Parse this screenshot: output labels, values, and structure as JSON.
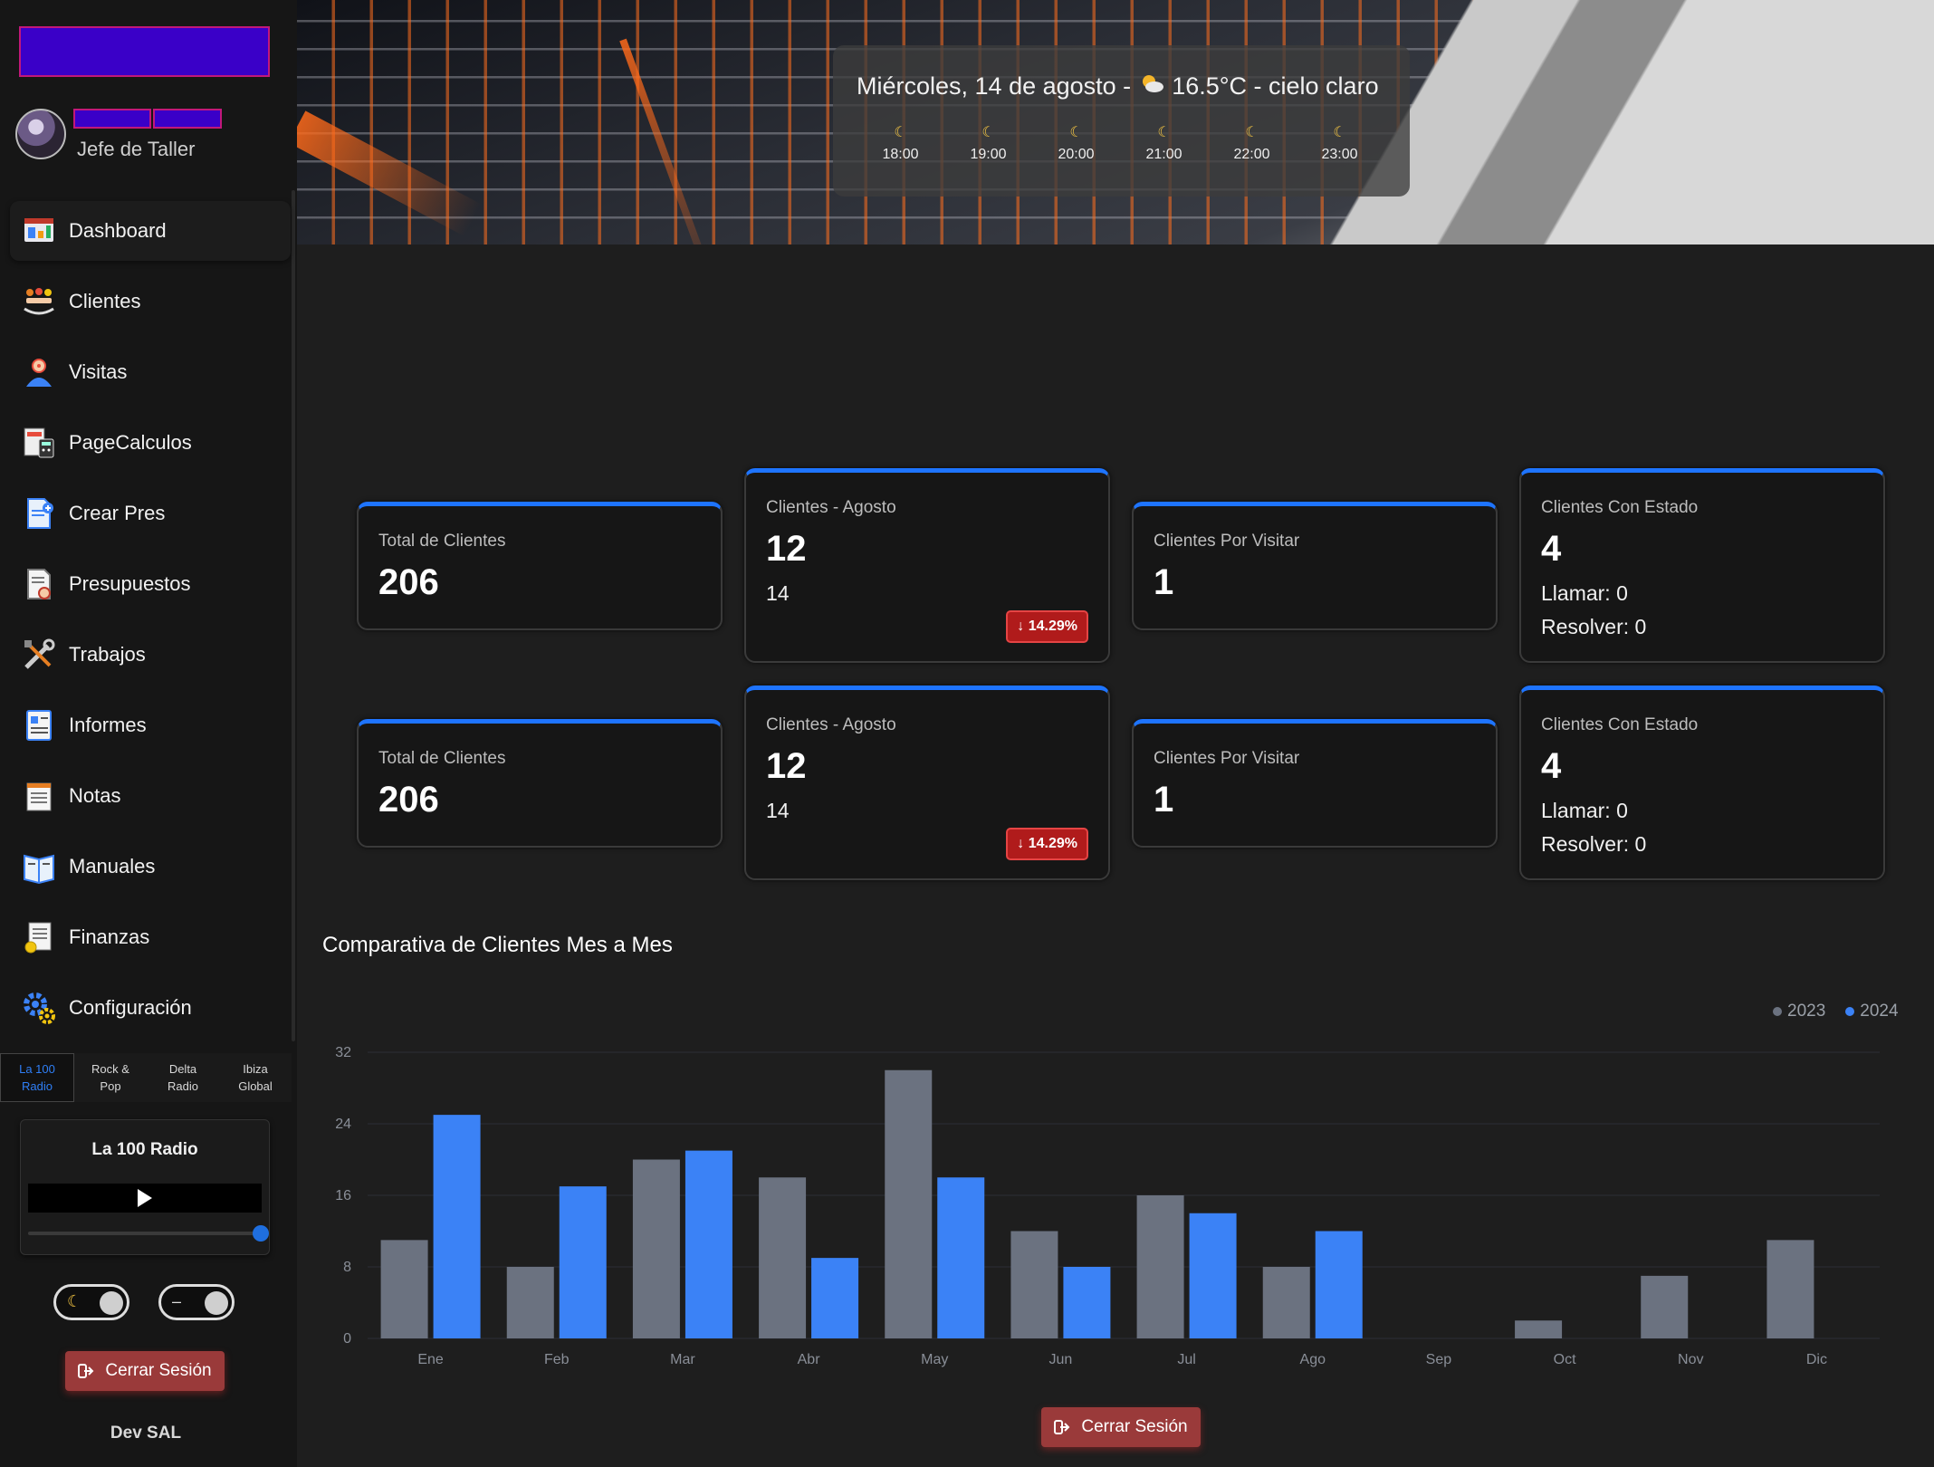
{
  "sidebar": {
    "user_role": "Jefe de Taller",
    "items": [
      {
        "label": "Dashboard",
        "icon": "dashboard-icon"
      },
      {
        "label": "Clientes",
        "icon": "clients-icon"
      },
      {
        "label": "Visitas",
        "icon": "visits-icon"
      },
      {
        "label": "PageCalculos",
        "icon": "calculator-icon"
      },
      {
        "label": "Crear Pres",
        "icon": "create-document-icon"
      },
      {
        "label": "Presupuestos",
        "icon": "budget-icon"
      },
      {
        "label": "Trabajos",
        "icon": "tools-icon"
      },
      {
        "label": "Informes",
        "icon": "report-icon"
      },
      {
        "label": "Notas",
        "icon": "notes-icon"
      },
      {
        "label": "Manuales",
        "icon": "book-icon"
      },
      {
        "label": "Finanzas",
        "icon": "finance-icon"
      },
      {
        "label": "Configuración",
        "icon": "gear-icon"
      }
    ],
    "radio_tabs": [
      {
        "line1": "La 100",
        "line2": "Radio"
      },
      {
        "line1": "Rock &",
        "line2": "Pop"
      },
      {
        "line1": "Delta",
        "line2": "Radio"
      },
      {
        "line1": "Ibiza",
        "line2": "Global"
      }
    ],
    "radio_player": {
      "title": "La 100 Radio",
      "volume": 1.0
    },
    "logout_label": "Cerrar Sesión",
    "dev_label": "Dev SAL"
  },
  "weather": {
    "summary": "Miércoles, 14 de agosto - ",
    "conditions": "16.5°C - cielo claro",
    "hours": [
      "18:00",
      "19:00",
      "20:00",
      "21:00",
      "22:00",
      "23:00"
    ]
  },
  "cards": [
    {
      "title": "Total de Clientes",
      "value": "206"
    },
    {
      "title": "Clientes - Agosto",
      "value": "12",
      "sub": "14",
      "badge": "↓ 14.29%"
    },
    {
      "title": "Clientes Por Visitar",
      "value": "1"
    },
    {
      "title": "Clientes Con Estado",
      "value": "4",
      "line1": "Llamar: 0",
      "line2": "Resolver: 0"
    }
  ],
  "chart_data": {
    "type": "bar",
    "title": "Comparativa de Clientes Mes a Mes",
    "categories": [
      "Ene",
      "Feb",
      "Mar",
      "Abr",
      "May",
      "Jun",
      "Jul",
      "Ago",
      "Sep",
      "Oct",
      "Nov",
      "Dic"
    ],
    "series": [
      {
        "name": "2023",
        "color": "#6b7280",
        "values": [
          11,
          8,
          20,
          18,
          30,
          12,
          16,
          8,
          0,
          2,
          7,
          11
        ]
      },
      {
        "name": "2024",
        "color": "#3b82f6",
        "values": [
          25,
          17,
          21,
          9,
          18,
          8,
          14,
          12,
          0,
          0,
          0,
          0
        ]
      }
    ],
    "ylim": [
      0,
      32
    ],
    "yticks": [
      0,
      8,
      16,
      24,
      32
    ],
    "legend": "top-right",
    "grid": true
  },
  "main": {
    "logout_label": "Cerrar Sesión"
  }
}
